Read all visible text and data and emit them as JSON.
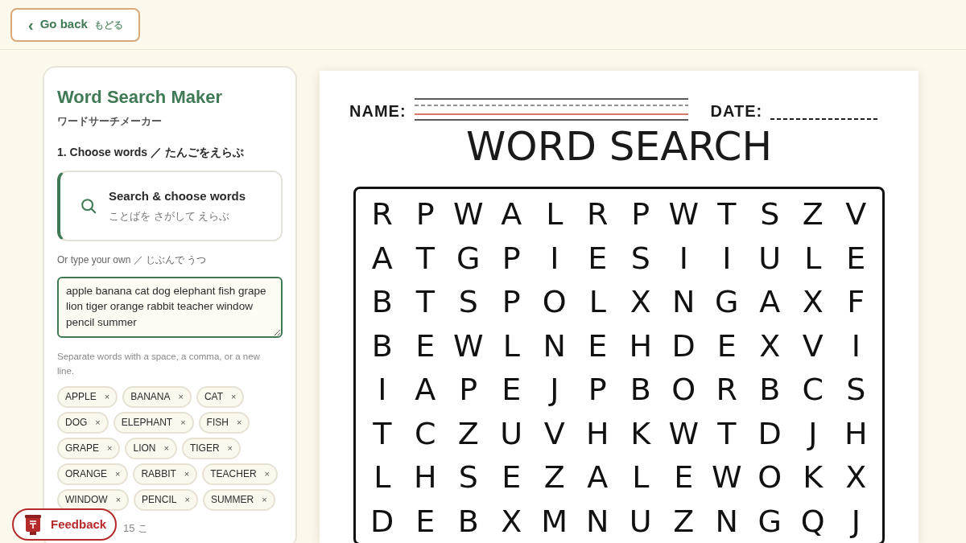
{
  "header": {
    "back_button": {
      "icon": "‹",
      "label": "Go back",
      "label_ja": "もどる"
    }
  },
  "panel": {
    "title": "Word Search Maker",
    "subtitle": "ワードサーチメーカー",
    "step_label": "1. Choose words ／ たんごをえらぶ",
    "search_card": {
      "title": "Search & choose words",
      "subtitle": "ことばを さがして えらぶ"
    },
    "own_label": "Or type your own ／ じぶんで うつ",
    "textarea_value": "apple banana cat dog elephant fish grape lion tiger orange rabbit teacher window pencil summer",
    "hint": "Separate words with a space, a comma, or a new line.",
    "chips": [
      {
        "label": "APPLE",
        "remove": "×"
      },
      {
        "label": "BANANA",
        "remove": "×"
      },
      {
        "label": "CAT",
        "remove": "×"
      },
      {
        "label": "DOG",
        "remove": "×"
      },
      {
        "label": "ELEPHANT",
        "remove": "×"
      },
      {
        "label": "FISH",
        "remove": "×"
      },
      {
        "label": "GRAPE",
        "remove": "×"
      },
      {
        "label": "LION",
        "remove": "×"
      },
      {
        "label": "TIGER",
        "remove": "×"
      },
      {
        "label": "ORANGE",
        "remove": "×"
      },
      {
        "label": "RABBIT",
        "remove": "×"
      },
      {
        "label": "TEACHER",
        "remove": "×"
      },
      {
        "label": "WINDOW",
        "remove": "×"
      },
      {
        "label": "PENCIL",
        "remove": "×"
      },
      {
        "label": "SUMMER",
        "remove": "×"
      }
    ],
    "count": "15 こ"
  },
  "worksheet": {
    "name_label": "NAME:",
    "date_label": "DATE:",
    "title": "WORD SEARCH",
    "grid": [
      [
        "R",
        "P",
        "W",
        "A",
        "L",
        "R",
        "P",
        "W",
        "T",
        "S",
        "Z",
        "V"
      ],
      [
        "A",
        "T",
        "G",
        "P",
        "I",
        "E",
        "S",
        "I",
        "I",
        "U",
        "L",
        "E"
      ],
      [
        "B",
        "T",
        "S",
        "P",
        "O",
        "L",
        "X",
        "N",
        "G",
        "A",
        "X",
        "F"
      ],
      [
        "B",
        "E",
        "W",
        "L",
        "N",
        "E",
        "H",
        "D",
        "E",
        "X",
        "V",
        "I"
      ],
      [
        "I",
        "A",
        "P",
        "E",
        "J",
        "P",
        "B",
        "O",
        "R",
        "B",
        "C",
        "S"
      ],
      [
        "T",
        "C",
        "Z",
        "U",
        "V",
        "H",
        "K",
        "W",
        "T",
        "D",
        "J",
        "H"
      ],
      [
        "L",
        "H",
        "S",
        "E",
        "Z",
        "A",
        "L",
        "E",
        "W",
        "O",
        "K",
        "X"
      ],
      [
        "D",
        "E",
        "B",
        "X",
        "M",
        "N",
        "U",
        "Z",
        "N",
        "G",
        "Q",
        "J"
      ]
    ]
  },
  "feedback_button": {
    "label": "Feedback"
  }
}
